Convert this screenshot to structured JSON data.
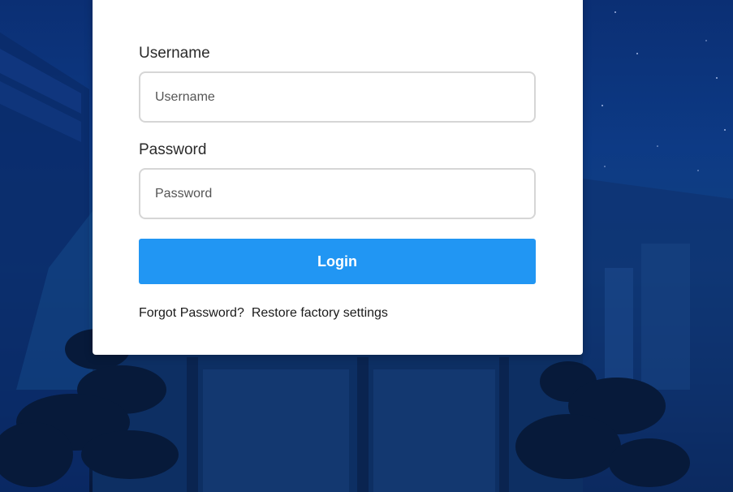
{
  "login_form": {
    "username_label": "Username",
    "username_placeholder": "Username",
    "username_value": "",
    "password_label": "Password",
    "password_placeholder": "Password",
    "password_value": "",
    "login_button": "Login",
    "forgot_password_link": "Forgot Password?",
    "restore_factory_link": "Restore factory settings"
  },
  "colors": {
    "accent": "#2196f3",
    "background": "#0d3a85",
    "card": "#ffffff",
    "input_border": "#d6d6d6"
  },
  "icons": {
    "background": "night-building-scene"
  }
}
